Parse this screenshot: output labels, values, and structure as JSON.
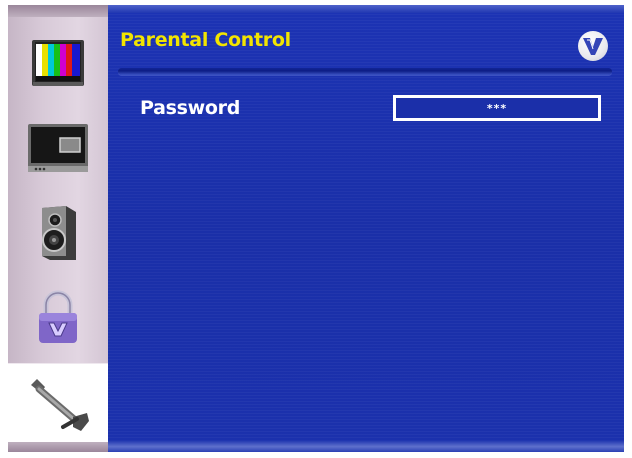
{
  "menu": {
    "title": "Parental Control",
    "brand_icon": "vizio-v-logo-icon",
    "accent_color": "#f2e400",
    "background_color": "#1c33b4"
  },
  "sidebar": {
    "items": [
      {
        "icon": "tv-picture-icon",
        "active": false
      },
      {
        "icon": "pip-screen-icon",
        "active": false
      },
      {
        "icon": "speaker-icon",
        "active": false
      },
      {
        "icon": "padlock-icon",
        "active": false
      },
      {
        "icon": "wrench-icon",
        "active": true
      }
    ]
  },
  "fields": {
    "password": {
      "label": "Password",
      "value": "***"
    }
  }
}
